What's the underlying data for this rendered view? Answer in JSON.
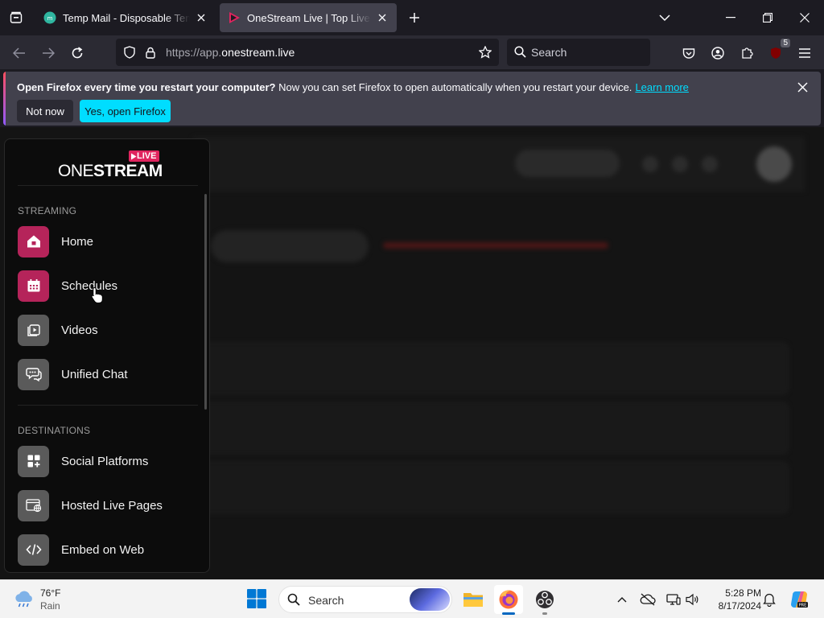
{
  "browser": {
    "tabs": [
      {
        "title": "Temp Mail - Disposable Temporary Email",
        "active": false
      },
      {
        "title": "OneStream Live | Top Live Streaming",
        "active": true
      }
    ],
    "url": {
      "scheme": "https://app.",
      "host": "onestream.live"
    },
    "search_placeholder": "Search",
    "extension_badge": "5"
  },
  "notification": {
    "bold": "Open Firefox every time you restart your computer?",
    "text": " Now you can set Firefox to open automatically when you restart your device.",
    "link": "Learn more",
    "not_now": "Not now",
    "yes": "Yes, open Firefox"
  },
  "sidebar": {
    "logo": {
      "one": "ONE",
      "stream": "STREAM",
      "live": "LIVE"
    },
    "sections": [
      {
        "label": "STREAMING",
        "items": [
          {
            "label": "Home",
            "icon": "home-icon",
            "active": true
          },
          {
            "label": "Schedules",
            "icon": "calendar-icon",
            "active": true
          },
          {
            "label": "Videos",
            "icon": "videos-icon",
            "active": false
          },
          {
            "label": "Unified Chat",
            "icon": "chat-icon",
            "active": false
          }
        ]
      },
      {
        "label": "DESTINATIONS",
        "items": [
          {
            "label": "Social Platforms",
            "icon": "social-platforms-icon",
            "active": false
          },
          {
            "label": "Hosted Live Pages",
            "icon": "hosted-pages-icon",
            "active": false
          },
          {
            "label": "Embed on Web",
            "icon": "embed-icon",
            "active": false
          }
        ]
      }
    ]
  },
  "taskbar": {
    "weather": {
      "temp": "76°F",
      "condition": "Rain"
    },
    "search": "Search",
    "time": "5:28 PM",
    "date": "8/17/2024"
  },
  "colors": {
    "accent_pink": "#b5245a",
    "firefox_cyan": "#00ddff",
    "grey_icon": "#5a5a5a"
  }
}
